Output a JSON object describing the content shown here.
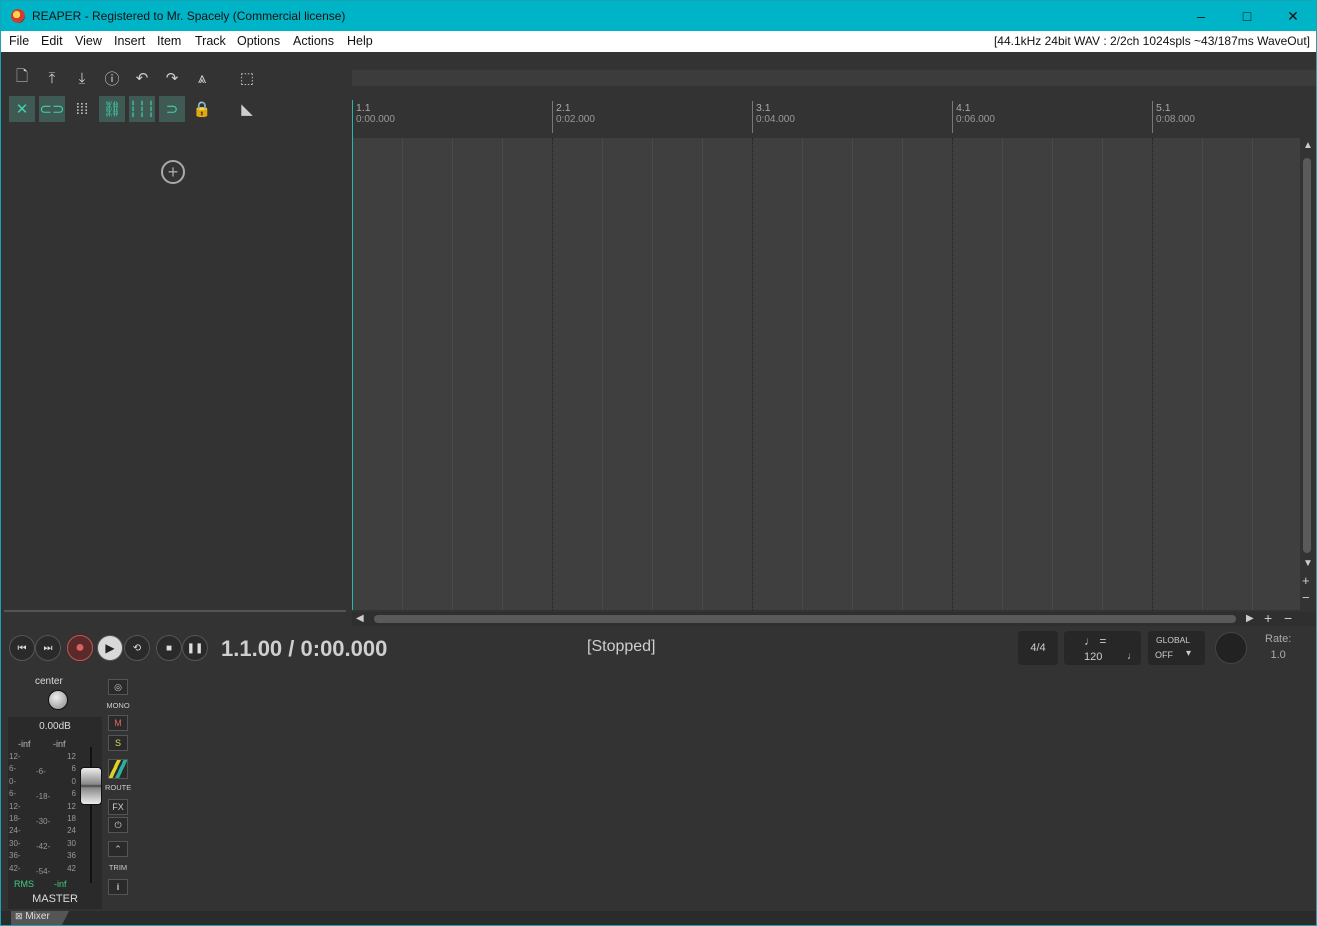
{
  "window": {
    "title": "REAPER - Registered to Mr. Spacely (Commercial license)",
    "minimize": "–",
    "maximize": "□",
    "close": "✕"
  },
  "menu": {
    "items": [
      "File",
      "Edit",
      "View",
      "Insert",
      "Item",
      "Track",
      "Options",
      "Actions",
      "Help"
    ],
    "status": "[44.1kHz 24bit WAV : 2/2ch 1024spls ~43/187ms WaveOut]"
  },
  "toolbar": {
    "row1": [
      "new-project-icon",
      "open-project-icon",
      "save-project-icon",
      "project-settings-icon",
      "undo-icon",
      "redo-icon",
      "metronome-icon"
    ],
    "row2": [
      "ripple-edit-icon",
      "item-grouping-icon",
      "grid-snap-icon",
      "envelope-lock-icon",
      "grid-lines-icon",
      "auto-crossfade-icon",
      "lock-icon"
    ],
    "add_track": "+"
  },
  "ruler": {
    "marks": [
      {
        "bar": "1.1",
        "time": "0:00.000"
      },
      {
        "bar": "2.1",
        "time": "0:02.000"
      },
      {
        "bar": "3.1",
        "time": "0:04.000"
      },
      {
        "bar": "4.1",
        "time": "0:06.000"
      },
      {
        "bar": "5.1",
        "time": "0:08.000"
      }
    ]
  },
  "transport": {
    "position": "1.1.00 / 0:00.000",
    "state": "[Stopped]",
    "time_sig": "4/4",
    "tempo_symbol": "♩ =",
    "tempo": "120",
    "global_label": "GLOBAL",
    "global_value": "OFF",
    "rate_label": "Rate:",
    "rate_value": "1.0",
    "buttons": {
      "go_start": "⏮",
      "go_end": "⏭",
      "record": "●",
      "play": "▶",
      "repeat": "⟲",
      "stop": "■",
      "pause": "❚❚"
    }
  },
  "mixer": {
    "pan_label": "center",
    "volume": "0.00dB",
    "peak_left": "-inf",
    "peak_right": "-inf",
    "scale_left": [
      "12",
      "6",
      "0",
      "6",
      "12",
      "18",
      "24",
      "30",
      "36",
      "42"
    ],
    "scale_mid": [
      "-6-",
      "-18-",
      "-30-",
      "-42-",
      "-54-"
    ],
    "scale_right": [
      "12",
      "6",
      "0",
      "6",
      "12",
      "18",
      "24",
      "30",
      "36",
      "42"
    ],
    "rms_label": "RMS",
    "rms_value": "-inf",
    "track_name": "MASTER",
    "side": {
      "mono": "MONO",
      "mute": "M",
      "solo": "S",
      "route": "ROUTE",
      "fx": "FX",
      "trim": "TRIM",
      "info": "i"
    },
    "tab_label": "Mixer"
  }
}
